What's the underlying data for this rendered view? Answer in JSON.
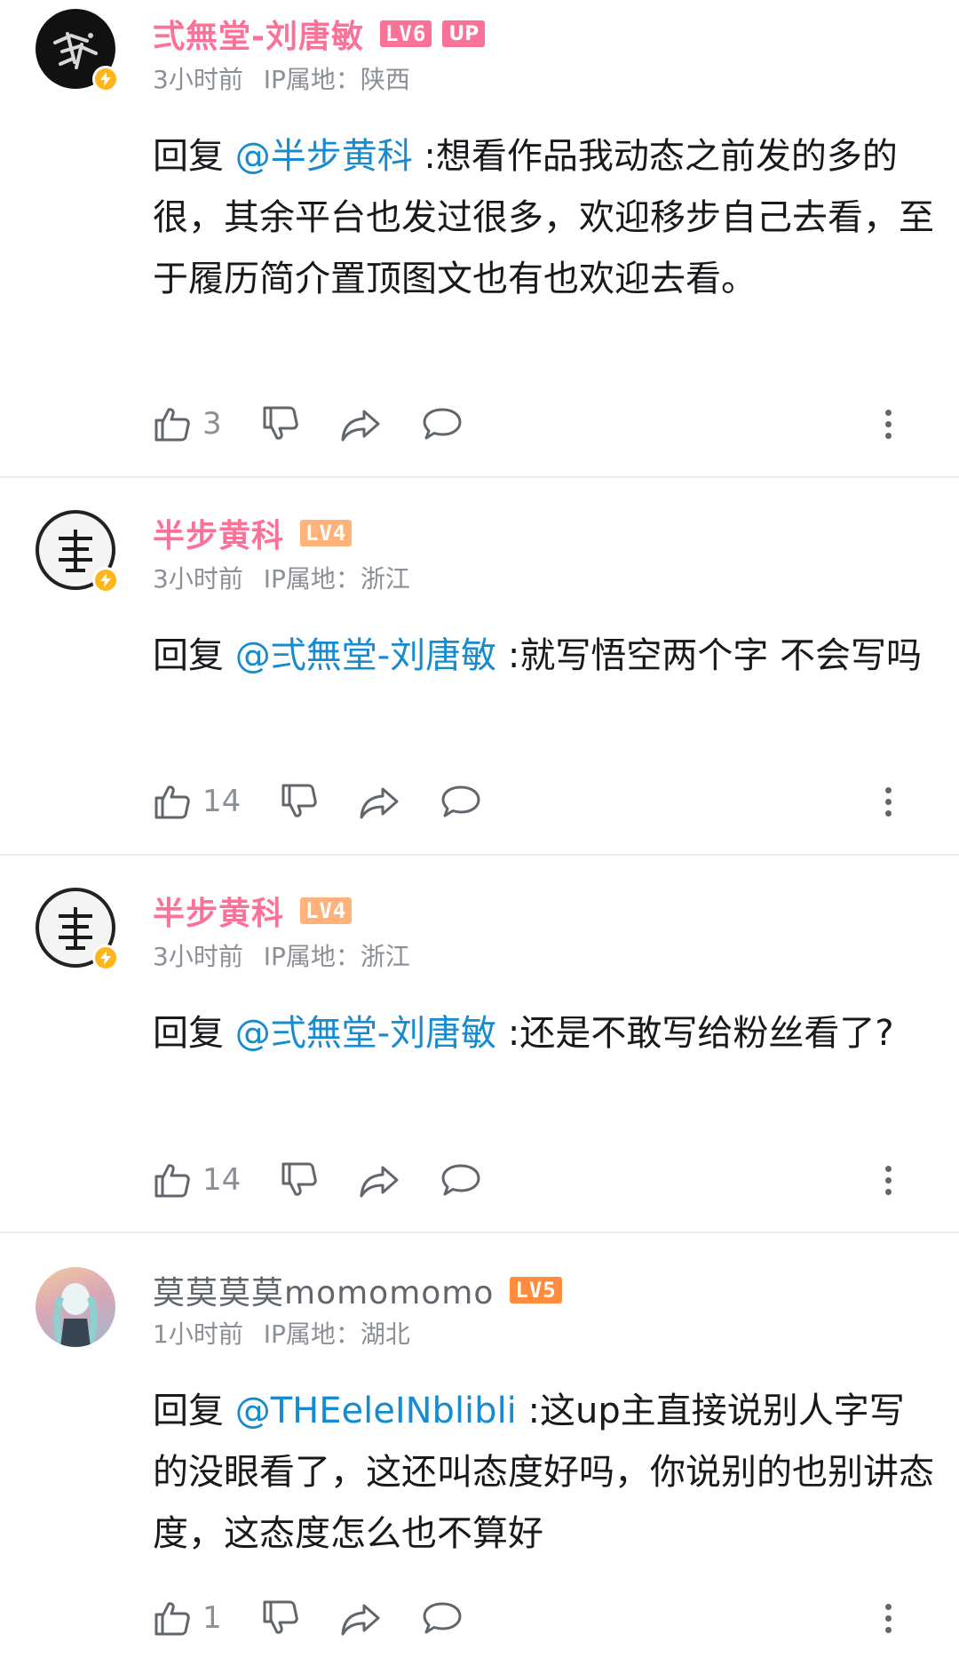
{
  "colors": {
    "vip_name": "#fb7299",
    "mention": "#178bcf",
    "lv6": "#fb7299",
    "lv5": "#ff8b3e",
    "lv4": "#ffb27a",
    "up_badge": "#fb7299",
    "bolt": "#ffb61e"
  },
  "comments": [
    {
      "username": "弍無堂-刘唐敏",
      "level": "LV6",
      "up_badge": "UP",
      "time": "3小时前",
      "ip": "IP属地：陕西",
      "reply_prefix": "回复 ",
      "mention": "@半步黄科",
      "text": " :想看作品我动态之前发的多的很，其余平台也发过很多，欢迎移步自己去看，至于履历简介置顶图文也有也欢迎去看。",
      "likes": "3"
    },
    {
      "username": "半步黄科",
      "level": "LV4",
      "time": "3小时前",
      "ip": "IP属地：浙江",
      "reply_prefix": "回复 ",
      "mention": "@弍無堂-刘唐敏",
      "text": " :就写悟空两个字 不会写吗",
      "likes": "14"
    },
    {
      "username": "半步黄科",
      "level": "LV4",
      "time": "3小时前",
      "ip": "IP属地：浙江",
      "reply_prefix": "回复 ",
      "mention": "@弍無堂-刘唐敏",
      "text": " :还是不敢写给粉丝看了?",
      "likes": "14"
    },
    {
      "username": "莫莫莫莫momomomo",
      "level": "LV5",
      "time": "1小时前",
      "ip": "IP属地：湖北",
      "reply_prefix": "回复 ",
      "mention": "@THEeleINblibli",
      "text": " :这up主直接说别人字写的没眼看了，这还叫态度好吗，你说别的也别讲态度，这态度怎么也不算好",
      "likes": "1"
    }
  ],
  "icons": {
    "like": "thumbs-up-icon",
    "dislike": "thumbs-down-icon",
    "share": "share-icon",
    "reply": "comment-icon",
    "more": "more-vertical-icon",
    "bolt": "lightning-icon"
  }
}
